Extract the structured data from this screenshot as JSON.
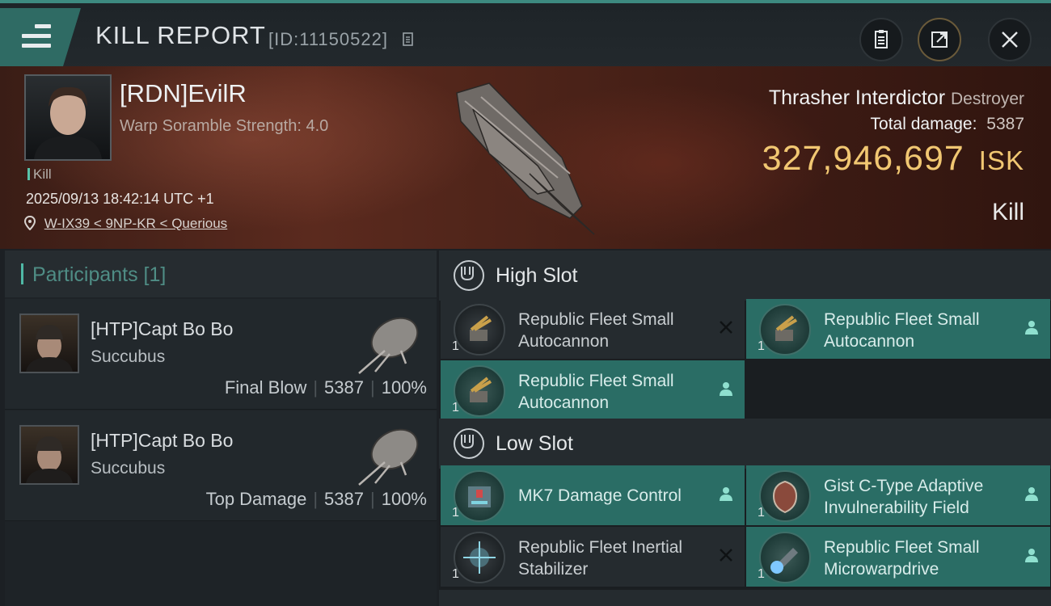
{
  "header": {
    "title": "KILL REPORT",
    "report_id": "[ID:11150522]"
  },
  "victim": {
    "name": "[RDN]EvilR",
    "stat": "Warp Soramble Strength: 4.0",
    "tag": "Kill",
    "timestamp": "2025/09/13 18:42:14 UTC +1",
    "location": "W-IX39 < 9NP-KR < Querious",
    "ship_name": "Thrasher Interdictor",
    "ship_class": "Destroyer",
    "total_damage_label": "Total damage:",
    "total_damage": "5387",
    "isk_value": "327,946,697",
    "isk_unit": "ISK",
    "result": "Kill"
  },
  "participants": {
    "label": "Participants [1]",
    "items": [
      {
        "name": "[HTP]Capt Bo Bo",
        "ship": "Succubus",
        "role": "Final Blow",
        "damage": "5387",
        "percent": "100%"
      },
      {
        "name": "[HTP]Capt Bo Bo",
        "ship": "Succubus",
        "role": "Top Damage",
        "damage": "5387",
        "percent": "100%"
      }
    ]
  },
  "high_slot": {
    "label": "High Slot",
    "modules": [
      {
        "name": "Republic Fleet Small Autocannon",
        "qty": "1",
        "status": "destroyed"
      },
      {
        "name": "Republic Fleet Small Autocannon",
        "qty": "1",
        "status": "dropped"
      },
      {
        "name": "Republic Fleet Small Autocannon",
        "qty": "1",
        "status": "dropped"
      }
    ]
  },
  "low_slot": {
    "label": "Low Slot",
    "modules": [
      {
        "name": "MK7 Damage Control",
        "qty": "1",
        "status": "dropped"
      },
      {
        "name": "Gist C-Type Adaptive Invulnerability Field",
        "qty": "1",
        "status": "dropped"
      },
      {
        "name": "Republic Fleet Inertial Stabilizer",
        "qty": "1",
        "status": "destroyed"
      },
      {
        "name": "Republic Fleet Small Microwarpdrive",
        "qty": "1",
        "status": "dropped"
      }
    ]
  },
  "colors": {
    "accent": "#2a6d65",
    "isk": "#f1c772",
    "topbar_border": "#3d8a80"
  },
  "icons": [
    "menu-icon",
    "copy-icon",
    "clipboard-icon",
    "share-icon",
    "close-icon",
    "location-pin-icon",
    "slot-icon",
    "pilot-icon",
    "destroyed-x-icon"
  ]
}
